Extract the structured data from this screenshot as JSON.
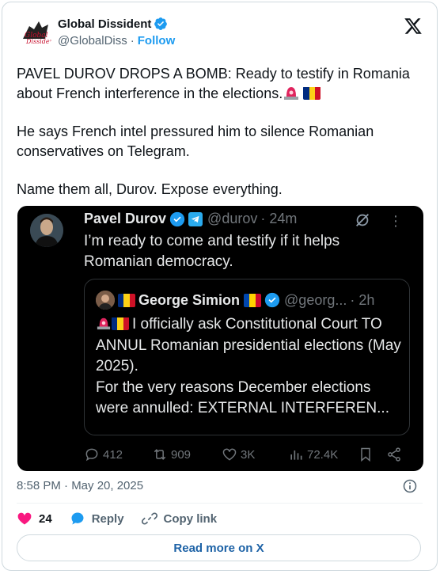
{
  "author": {
    "display_name": "Global Dissident",
    "handle": "@GlobalDiss",
    "separator": "·",
    "follow_label": "Follow",
    "verified_color": "#1d9bf0"
  },
  "tweet": {
    "paragraphs": [
      "PAVEL DUROV DROPS A BOMB: Ready to testify in Romania about French interference in the elections.",
      "He says French intel pressured him to silence Romanian conservatives on Telegram.",
      "Name them all, Durov. Expose everything."
    ],
    "timestamp": "8:58 PM · May 20, 2025"
  },
  "embedded": {
    "display_name": "Pavel Durov",
    "handle": "@durov",
    "time": "· 24m",
    "text": "I’m ready to come and testify if it helps Romanian democracy.",
    "quote": {
      "display_name": "George Simion",
      "handle": "@georg...",
      "time": "· 2h",
      "text_line1": "I officially ask Constitutional Court TO ANNUL Romanian presidential elections (May 2025).",
      "text_line2": "For the very reasons December elections were annulled: EXTERNAL INTERFEREN..."
    },
    "actions": {
      "replies": "412",
      "reposts": "909",
      "likes": "3K",
      "views": "72.4K"
    }
  },
  "engagement": {
    "likes": "24",
    "reply_label": "Reply",
    "copy_link_label": "Copy link",
    "heart_color": "#f91880"
  },
  "read_more_label": "Read more on X"
}
